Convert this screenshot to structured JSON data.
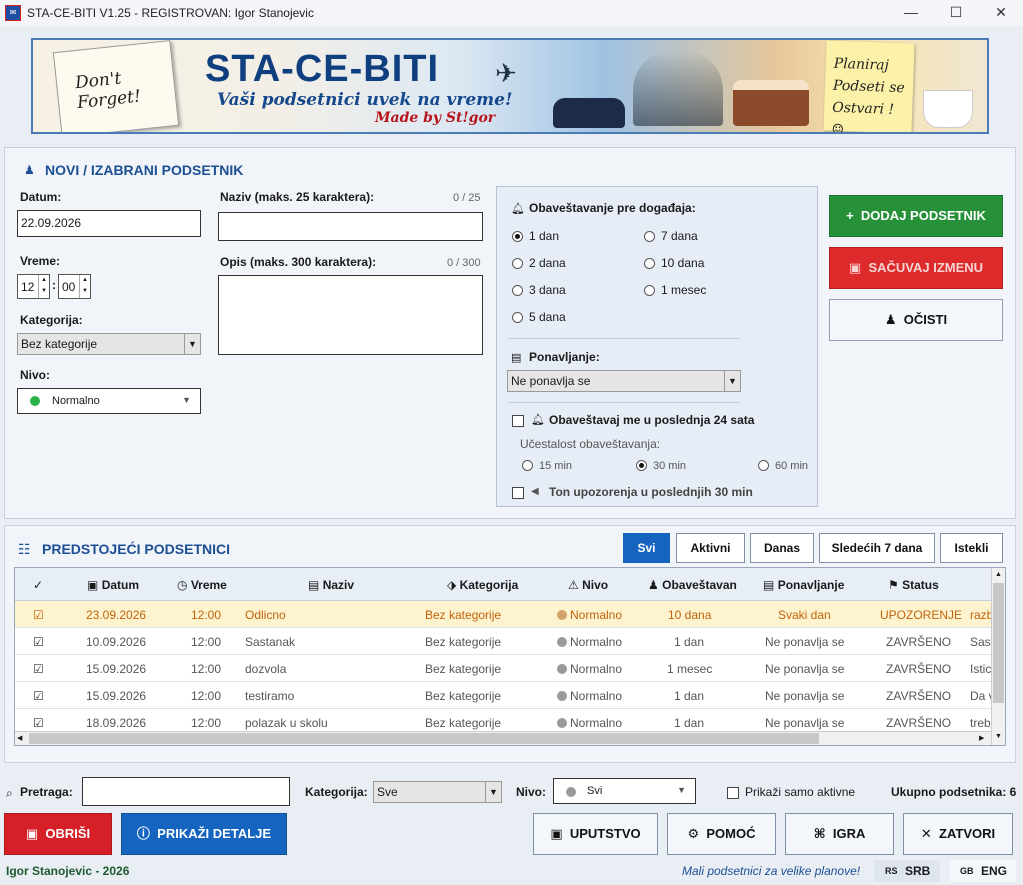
{
  "window": {
    "title": "STA-CE-BITI V1.25 - REGISTROVAN: Igor Stanojevic",
    "minimize": "—",
    "maximize": "☐",
    "close": "✕"
  },
  "banner": {
    "note": "Don't Forget!",
    "brand": "STA-CE-BITI",
    "tagline": "Vaši podsetnici uvek na vreme!",
    "made_by": "Made by St!gor",
    "sticky": "Planiraj Podseti se Ostvari ! ☺"
  },
  "form": {
    "title": "NOVI / IZABRANI PODSETNIK",
    "datum_label": "Datum:",
    "datum_value": "22.09.2026",
    "vreme_label": "Vreme:",
    "vreme_hour": "12",
    "vreme_min": "00",
    "kategorija_label": "Kategorija:",
    "kategorija_value": "Bez kategorije",
    "nivo_label": "Nivo:",
    "nivo_value": "Normalno",
    "naziv_label": "Naziv (maks. 25 karaktera):",
    "naziv_counter": "0 / 25",
    "opis_label": "Opis (maks. 300 karaktera):",
    "opis_counter": "0 / 300",
    "notify_label": "Obaveštavanje pre događaja:",
    "notify_options": [
      "1 dan",
      "2 dana",
      "3 dana",
      "5 dana",
      "7 dana",
      "10 dana",
      "1 mesec"
    ],
    "notify_selected": "1 dan",
    "repeat_label": "Ponavljanje:",
    "repeat_value": "Ne ponavlja se",
    "last24_label": "Obaveštavaj me u poslednja 24 sata",
    "freq_label": "Učestalost obaveštavanja:",
    "freq_options": [
      "15 min",
      "30 min",
      "60 min"
    ],
    "freq_selected": "30 min",
    "ton_label": "Ton upozorenja u poslednjih 30 min"
  },
  "actions": {
    "add": "DODAJ PODSETNIK",
    "save": "SAČUVAJ IZMENU",
    "clear": "OČISTI"
  },
  "list": {
    "title": "PREDSTOJEĆI PODSETNICI",
    "tabs": [
      "Svi",
      "Aktivni",
      "Danas",
      "Sledećih 7 dana",
      "Istekli"
    ],
    "active_tab": "Svi",
    "columns": [
      "✓",
      "Datum",
      "Vreme",
      "Naziv",
      "Kategorija",
      "Nivo",
      "Obaveštavan",
      "Ponavljanje",
      "Status"
    ],
    "rows": [
      {
        "check": "☑",
        "datum": "23.09.2026",
        "vreme": "12:00",
        "naziv": "Odlicno",
        "kategorija": "Bez kategorije",
        "nivo": "Normalno",
        "obav": "10 dana",
        "ponav": "Svaki dan",
        "status": "UPOZORENJE",
        "opis": "razb"
      },
      {
        "check": "☑",
        "datum": "10.09.2026",
        "vreme": "12:00",
        "naziv": "Sastanak",
        "kategorija": "Bez kategorije",
        "nivo": "Normalno",
        "obav": "1 dan",
        "ponav": "Ne ponavlja se",
        "status": "ZAVRŠENO",
        "opis": "Sast"
      },
      {
        "check": "☑",
        "datum": "15.09.2026",
        "vreme": "12:00",
        "naziv": "dozvola",
        "kategorija": "Bez kategorije",
        "nivo": "Normalno",
        "obav": "1 mesec",
        "ponav": "Ne ponavlja se",
        "status": "ZAVRŠENO",
        "opis": "Istic"
      },
      {
        "check": "☑",
        "datum": "15.09.2026",
        "vreme": "12:00",
        "naziv": "testiramo",
        "kategorija": "Bez kategorije",
        "nivo": "Normalno",
        "obav": "1 dan",
        "ponav": "Ne ponavlja se",
        "status": "ZAVRŠENO",
        "opis": "Da v"
      },
      {
        "check": "☑",
        "datum": "18.09.2026",
        "vreme": "12:00",
        "naziv": "polazak u skolu",
        "kategorija": "Bez kategorije",
        "nivo": "Normalno",
        "obav": "1 dan",
        "ponav": "Ne ponavlja se",
        "status": "ZAVRŠENO",
        "opis": "treb"
      }
    ]
  },
  "filters": {
    "search_label": "Pretraga:",
    "search_value": "",
    "kategorija_label": "Kategorija:",
    "kategorija_value": "Sve",
    "nivo_label": "Nivo:",
    "nivo_value": "Svi",
    "active_only": "Prikaži samo aktivne",
    "total_label": "Ukupno podsetnika: 6"
  },
  "bottom": {
    "delete": "OBRIŠI",
    "details": "PRIKAŽI DETALJE",
    "manual": "UPUTSTVO",
    "help": "POMOĆ",
    "game": "IGRA",
    "close": "ZATVORI"
  },
  "status": {
    "author": "Igor Stanojevic - 2026",
    "motto": "Mali podsetnici za velike planove!",
    "lang_rs": "RS",
    "lang_srb": "SRB",
    "lang_gb": "GB",
    "lang_eng": "ENG"
  },
  "colors": {
    "accent": "#1565c0",
    "add": "#27913a",
    "save": "#dd2a2a",
    "delete": "#d61f26",
    "details": "#1565c0",
    "highlight_row": "#fdf3cf"
  }
}
